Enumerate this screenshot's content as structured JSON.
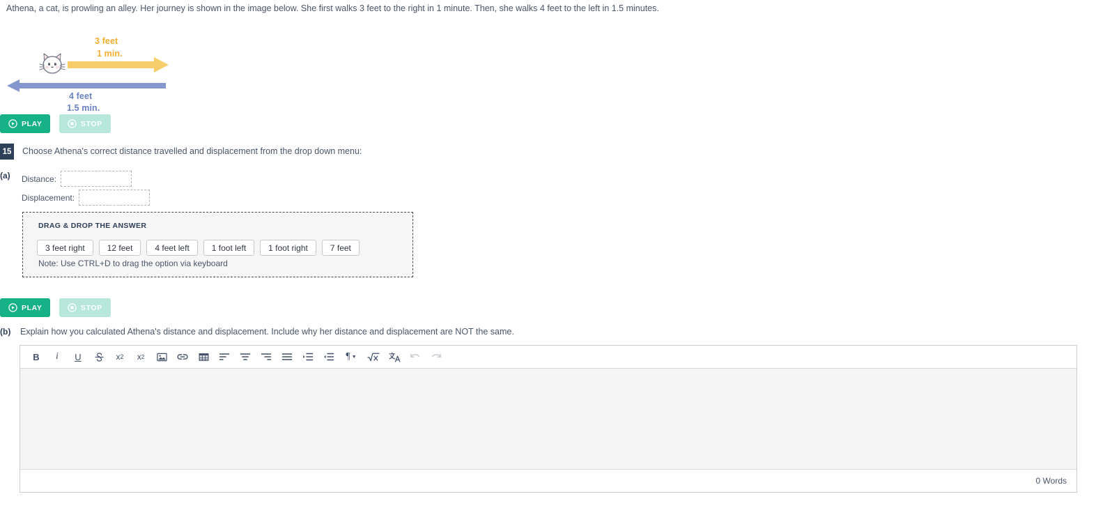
{
  "intro": {
    "text": "Athena, a cat, is prowling an alley. Her journey is shown in the image below. She first walks 3 feet to the right in 1 minute. Then, she walks 4 feet to the left in 1.5 minutes."
  },
  "diagram": {
    "cat_icon": "cat-face-icon",
    "forward_leg": {
      "distance_label": "3 feet",
      "time_label": "1 min.",
      "color": "#f0ad2e",
      "direction": "right"
    },
    "backward_leg": {
      "distance_label": "4 feet",
      "time_label": "1.5 min.",
      "color": "#6b82c4",
      "direction": "left"
    }
  },
  "media_controls_top": {
    "play_label": "PLAY",
    "stop_label": "STOP",
    "play_icon": "play-circle-icon",
    "stop_icon": "stop-circle-icon",
    "play_color": "#16b187",
    "stop_color": "#b6e7da"
  },
  "media_controls_bottom": {
    "play_label": "PLAY",
    "stop_label": "STOP",
    "play_icon": "play-circle-icon",
    "stop_icon": "stop-circle-icon"
  },
  "question": {
    "number": "15",
    "badge_color": "#2e4059",
    "prompt": "Choose Athena's correct distance travelled and displacement from the drop down menu:",
    "part_a": {
      "marker": "(a)",
      "distance_label": "Distance:",
      "distance_value": "",
      "displacement_label": "Displacement:",
      "displacement_value": ""
    },
    "part_b": {
      "marker": "(b)",
      "prompt": "Explain how you calculated Athena's distance and displacement. Include why her distance and displacement are NOT the same."
    }
  },
  "drag_drop": {
    "title": "DRAG & DROP THE ANSWER",
    "options": [
      "3 feet right",
      "12 feet",
      "4 feet left",
      "1 foot left",
      "1 foot right",
      "7 feet"
    ],
    "note": "Note: Use CTRL+D to drag the option via keyboard"
  },
  "editor": {
    "toolbar": [
      {
        "name": "bold-icon",
        "title": "Bold",
        "disabled": false
      },
      {
        "name": "italic-icon",
        "title": "Italic",
        "disabled": false
      },
      {
        "name": "underline-icon",
        "title": "Underline",
        "disabled": false
      },
      {
        "name": "strikethrough-icon",
        "title": "Strikethrough",
        "disabled": false
      },
      {
        "name": "subscript-icon",
        "title": "Subscript",
        "disabled": false
      },
      {
        "name": "superscript-icon",
        "title": "Superscript",
        "disabled": false
      },
      {
        "name": "image-icon",
        "title": "Insert image",
        "disabled": false
      },
      {
        "name": "link-icon",
        "title": "Insert link",
        "disabled": false
      },
      {
        "name": "table-icon",
        "title": "Insert table",
        "disabled": false
      },
      {
        "name": "align-left-icon",
        "title": "Align left",
        "disabled": false
      },
      {
        "name": "align-center-icon",
        "title": "Align center",
        "disabled": false
      },
      {
        "name": "align-right-icon",
        "title": "Align right",
        "disabled": false
      },
      {
        "name": "align-justify-icon",
        "title": "Justify",
        "disabled": false
      },
      {
        "name": "indent-icon",
        "title": "Increase indent",
        "disabled": false
      },
      {
        "name": "outdent-icon",
        "title": "Decrease indent",
        "disabled": false
      },
      {
        "name": "paragraph-format-icon",
        "title": "Paragraph format",
        "disabled": false
      },
      {
        "name": "math-equation-icon",
        "title": "Insert equation",
        "disabled": false
      },
      {
        "name": "language-icon",
        "title": "Language",
        "disabled": false
      },
      {
        "name": "undo-icon",
        "title": "Undo",
        "disabled": true
      },
      {
        "name": "redo-icon",
        "title": "Redo",
        "disabled": true
      }
    ],
    "content": "",
    "word_count": "0 Words"
  }
}
